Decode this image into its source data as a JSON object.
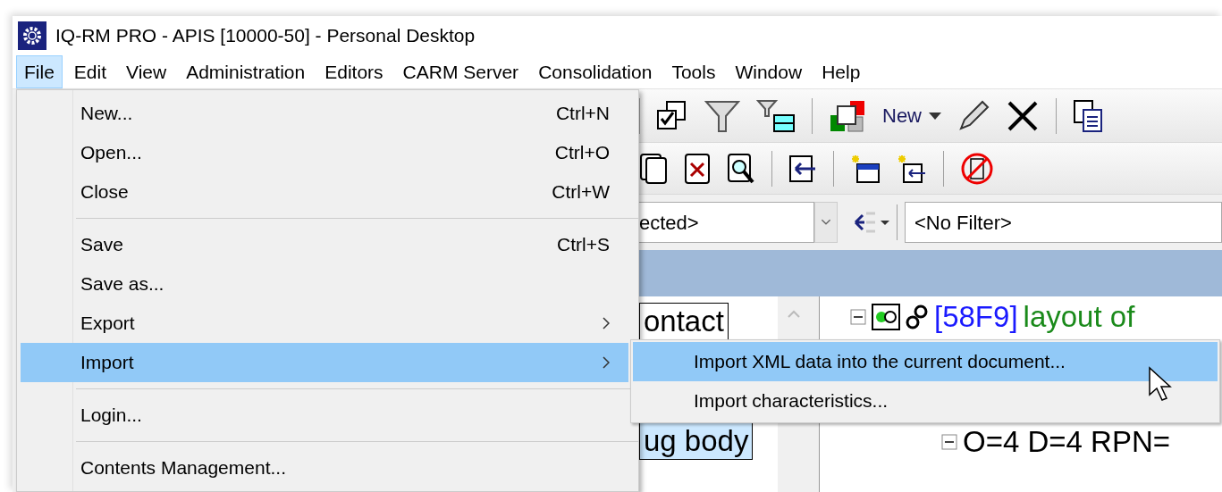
{
  "window": {
    "title": "IQ-RM PRO - APIS [10000-50] - Personal Desktop"
  },
  "menu_bar": [
    {
      "label": "File",
      "selected": true
    },
    {
      "label": "Edit",
      "selected": false
    },
    {
      "label": "View",
      "selected": false
    },
    {
      "label": "Administration",
      "selected": false
    },
    {
      "label": "Editors",
      "selected": false
    },
    {
      "label": "CARM Server",
      "selected": false
    },
    {
      "label": "Consolidation",
      "selected": false
    },
    {
      "label": "Tools",
      "selected": false
    },
    {
      "label": "Window",
      "selected": false
    },
    {
      "label": "Help",
      "selected": false
    }
  ],
  "toolbar": {
    "new_button": "New",
    "project_combo": {
      "value": "ected>"
    },
    "filter_combo": {
      "value": "<No Filter>"
    }
  },
  "left_panel": {
    "items": [
      {
        "label": "ontact",
        "selected": false
      },
      {
        "label": "ug body",
        "selected": true
      }
    ]
  },
  "tree": {
    "nodes": [
      {
        "id": "[58F9]",
        "text": "layout of",
        "expanded": true,
        "children": [
          {
            "text": "O=4 D=4 RPN=",
            "expanded": true
          }
        ]
      }
    ]
  },
  "file_menu": {
    "items": [
      {
        "kind": "item",
        "label": "New...",
        "shortcut": "Ctrl+N",
        "submenu": false,
        "selected": false
      },
      {
        "kind": "item",
        "label": "Open...",
        "shortcut": "Ctrl+O",
        "submenu": false,
        "selected": false
      },
      {
        "kind": "item",
        "label": "Close",
        "shortcut": "Ctrl+W",
        "submenu": false,
        "selected": false
      },
      {
        "kind": "separator"
      },
      {
        "kind": "item",
        "label": "Save",
        "shortcut": "Ctrl+S",
        "submenu": false,
        "selected": false
      },
      {
        "kind": "item",
        "label": "Save as...",
        "submenu": false,
        "selected": false
      },
      {
        "kind": "item",
        "label": "Export",
        "submenu": true,
        "selected": false
      },
      {
        "kind": "item",
        "label": "Import",
        "submenu": true,
        "selected": true
      },
      {
        "kind": "separator"
      },
      {
        "kind": "item",
        "label": "Login...",
        "submenu": false,
        "selected": false
      },
      {
        "kind": "separator"
      },
      {
        "kind": "item",
        "label": "Contents Management...",
        "submenu": false,
        "selected": false
      }
    ]
  },
  "import_submenu": {
    "items": [
      {
        "label": "Import XML data into the current document...",
        "selected": true
      },
      {
        "label": "Import characteristics...",
        "selected": false
      }
    ]
  }
}
